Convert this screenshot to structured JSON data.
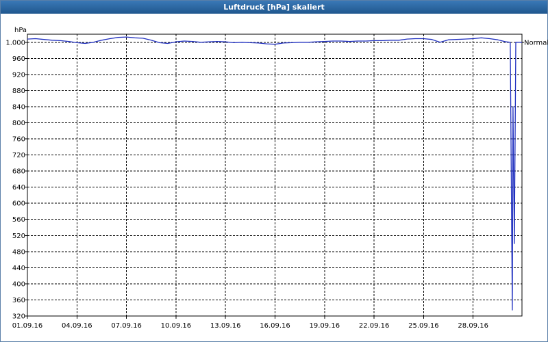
{
  "window": {
    "title": "Luftdruck [hPa] skaliert"
  },
  "colors": {
    "title_bar": "#2e6aa6",
    "series": "#1f2fbf",
    "grid": "#000000"
  },
  "chart_data": {
    "type": "line",
    "title": "Luftdruck [hPa] skaliert",
    "ylabel": "hPa",
    "xlabel": "",
    "ylim": [
      320,
      1020
    ],
    "xlim": [
      "2016-09-01",
      "2016-09-31"
    ],
    "grid": true,
    "y_ticks": [
      1000,
      960,
      920,
      880,
      840,
      800,
      760,
      720,
      680,
      640,
      600,
      560,
      520,
      480,
      440,
      400,
      360,
      320
    ],
    "y_tick_labels": [
      "1.000",
      "960",
      "920",
      "880",
      "840",
      "800",
      "760",
      "720",
      "680",
      "640",
      "600",
      "560",
      "520",
      "480",
      "440",
      "400",
      "360",
      "320"
    ],
    "x_ticks": [
      "01.09.16",
      "04.09.16",
      "07.09.16",
      "10.09.16",
      "13.09.16",
      "16.09.16",
      "19.09.16",
      "22.09.16",
      "25.09.16",
      "28.09.16"
    ],
    "reference_line": {
      "label": "Normal",
      "value": 1000
    },
    "series": [
      {
        "values": [
          [
            "01.09.16 00:00",
            1008
          ],
          [
            "01.09.16 12:00",
            1009
          ],
          [
            "02.09.16 00:00",
            1007
          ],
          [
            "02.09.16 12:00",
            1005
          ],
          [
            "03.09.16 00:00",
            1004
          ],
          [
            "03.09.16 12:00",
            1002
          ],
          [
            "04.09.16 00:00",
            999
          ],
          [
            "04.09.16 12:00",
            997
          ],
          [
            "05.09.16 00:00",
            1000
          ],
          [
            "05.09.16 12:00",
            1005
          ],
          [
            "06.09.16 00:00",
            1009
          ],
          [
            "06.09.16 12:00",
            1012
          ],
          [
            "07.09.16 00:00",
            1013
          ],
          [
            "07.09.16 12:00",
            1011
          ],
          [
            "08.09.16 00:00",
            1010
          ],
          [
            "08.09.16 12:00",
            1005
          ],
          [
            "09.09.16 00:00",
            999
          ],
          [
            "09.09.16 12:00",
            997
          ],
          [
            "10.09.16 00:00",
            1001
          ],
          [
            "10.09.16 12:00",
            1003
          ],
          [
            "11.09.16 00:00",
            1002
          ],
          [
            "11.09.16 12:00",
            1000
          ],
          [
            "12.09.16 00:00",
            1001
          ],
          [
            "12.09.16 12:00",
            1002
          ],
          [
            "13.09.16 00:00",
            1001
          ],
          [
            "13.09.16 12:00",
            999
          ],
          [
            "14.09.16 00:00",
            1000
          ],
          [
            "14.09.16 12:00",
            999
          ],
          [
            "15.09.16 00:00",
            998
          ],
          [
            "15.09.16 12:00",
            996
          ],
          [
            "16.09.16 00:00",
            995
          ],
          [
            "16.09.16 12:00",
            998
          ],
          [
            "17.09.16 00:00",
            999
          ],
          [
            "17.09.16 12:00",
            1000
          ],
          [
            "18.09.16 00:00",
            1000
          ],
          [
            "18.09.16 12:00",
            1001
          ],
          [
            "19.09.16 00:00",
            1002
          ],
          [
            "19.09.16 12:00",
            1003
          ],
          [
            "20.09.16 00:00",
            1003
          ],
          [
            "20.09.16 12:00",
            1002
          ],
          [
            "21.09.16 00:00",
            1003
          ],
          [
            "21.09.16 12:00",
            1003
          ],
          [
            "22.09.16 00:00",
            1004
          ],
          [
            "22.09.16 12:00",
            1004
          ],
          [
            "23.09.16 00:00",
            1005
          ],
          [
            "23.09.16 12:00",
            1005
          ],
          [
            "24.09.16 00:00",
            1008
          ],
          [
            "24.09.16 12:00",
            1009
          ],
          [
            "25.09.16 00:00",
            1009
          ],
          [
            "25.09.16 12:00",
            1007
          ],
          [
            "26.09.16 00:00",
            1000
          ],
          [
            "26.09.16 12:00",
            1006
          ],
          [
            "27.09.16 00:00",
            1007
          ],
          [
            "27.09.16 12:00",
            1008
          ],
          [
            "28.09.16 00:00",
            1009
          ],
          [
            "28.09.16 12:00",
            1011
          ],
          [
            "29.09.16 00:00",
            1009
          ],
          [
            "29.09.16 12:00",
            1006
          ],
          [
            "30.09.16 00:00",
            1001
          ],
          [
            "30.09.16 06:00",
            1000
          ],
          [
            "30.09.16 09:00",
            335
          ],
          [
            "30.09.16 10:00",
            840
          ],
          [
            "30.09.16 12:00",
            500
          ],
          [
            "30.09.16 14:00",
            1000
          ],
          [
            "30.09.16 23:00",
            1000
          ]
        ]
      }
    ]
  }
}
